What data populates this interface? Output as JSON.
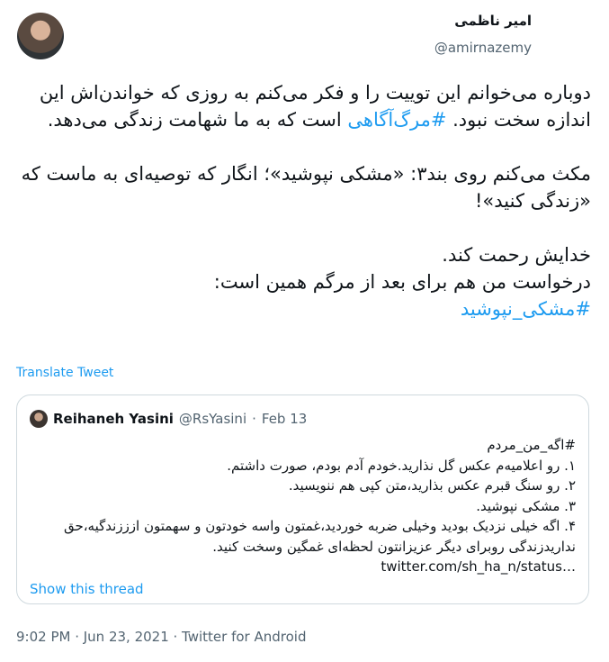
{
  "author": {
    "name": "امیر ناظمی",
    "handle": "@amirnazemy"
  },
  "more_icon": "more-horizontal-icon",
  "body": {
    "line1_a": "دوباره می‌خوانم این توییت را و فکر می‌کنم به روزی که خواندن‌اش این اندازه سخت نبود. ",
    "line1_tag": "#مرگ‌آگاهی",
    "line1_b": " است که به ما شهامت زندگی می‌دهد.",
    "para2": "مکث می‌کنم روی بند۳: «مشکی نپوشید»؛ انگار که توصیه‌ای به ماست که «زندگی کنید»!",
    "para3_a": "خدایش رحمت کند.",
    "para3_b": "درخواست من هم برای بعد از مرگم همین است:",
    "para3_tag": "#مشکی_نپوشید"
  },
  "translate_label": "Translate Tweet",
  "quote": {
    "name": "Reihaneh Yasini",
    "handle": "@RsYasini",
    "separator": "·",
    "date": "Feb 13",
    "lines": [
      "#اگه_من_مردم",
      "۱. رو اعلامیه‌م عکس گل نذارید.خودم آدم بودم، صورت داشتم.",
      "۲. رو سنگ قبرم عکس بذارید،متن کپی هم ننویسید.",
      "۳. مشکی نپوشید.",
      "۴. اگه خیلی نزدیک بودید وخیلی ضربه خوردید،غمتون واسه خودتون و سهمتون ازززندگیه،حق ندارید‌زندگی روبرای دیگر عزیزانتون لحظه‌ای غمگین وسخت کنید."
    ],
    "link": "twitter.com/sh_ha_n/status…",
    "show_thread": "Show this thread"
  },
  "meta": "9:02 PM · Jun 23, 2021 · Twitter for Android",
  "colors": {
    "accent": "#1d9bf0",
    "secondary_text": "#536471",
    "border": "#cfd9de"
  }
}
